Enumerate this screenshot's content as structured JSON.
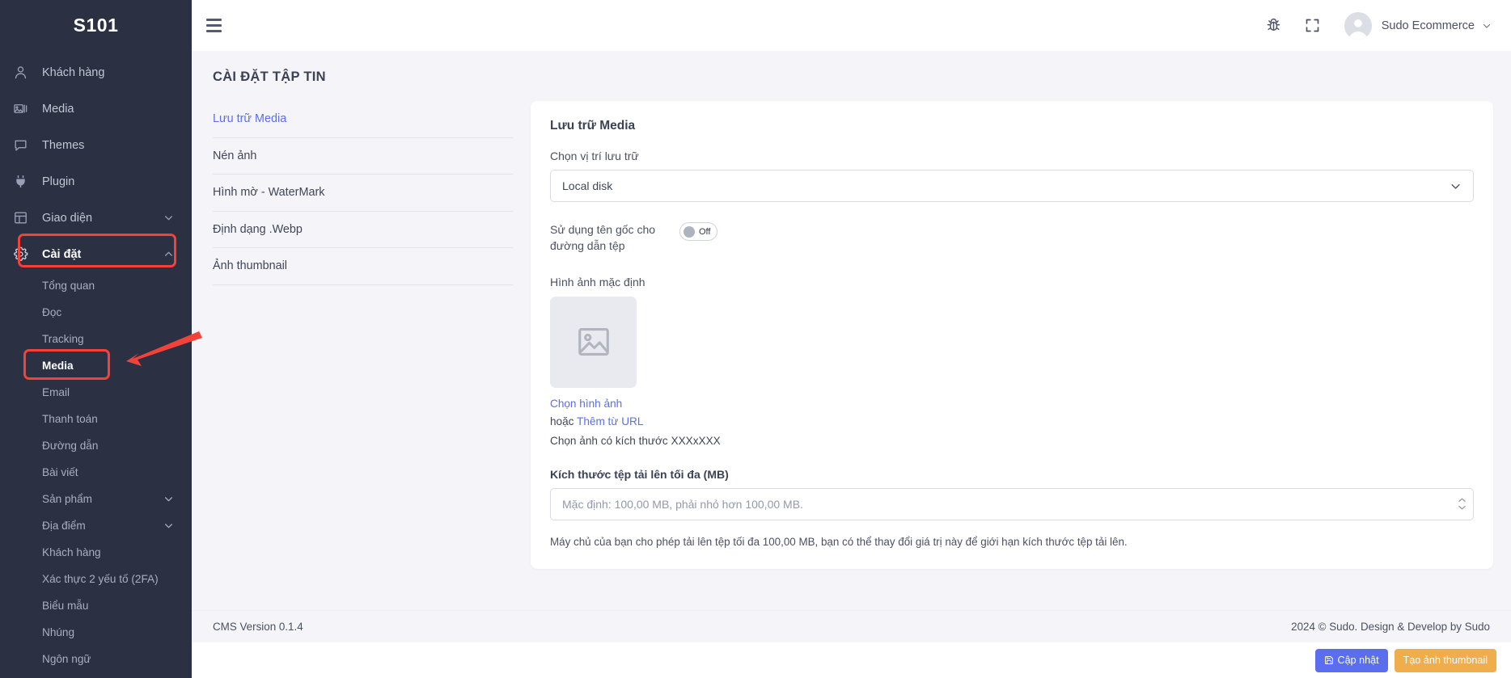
{
  "sidebar": {
    "brand": "S101",
    "items": [
      {
        "label": "Khách hàng",
        "icon": "user-icon",
        "has_chevron": false
      },
      {
        "label": "Media",
        "icon": "images-icon",
        "has_chevron": false
      },
      {
        "label": "Themes",
        "icon": "chat-icon",
        "has_chevron": false
      },
      {
        "label": "Plugin",
        "icon": "plug-icon",
        "has_chevron": false
      },
      {
        "label": "Giao diện",
        "icon": "layout-icon",
        "has_chevron": true,
        "chevron": "chevron-down-icon"
      },
      {
        "label": "Cài đặt",
        "icon": "gear-icon",
        "has_chevron": true,
        "chevron": "chevron-up-icon",
        "active": true,
        "annotated": true
      }
    ],
    "subitems": [
      {
        "label": "Tổng quan"
      },
      {
        "label": "Đọc"
      },
      {
        "label": "Tracking"
      },
      {
        "label": "Media",
        "selected": true,
        "annotated": true
      },
      {
        "label": "Email"
      },
      {
        "label": "Thanh toán"
      },
      {
        "label": "Đường dẫn"
      },
      {
        "label": "Bài viết"
      },
      {
        "label": "Sản phẩm",
        "has_chevron": true
      },
      {
        "label": "Địa điểm",
        "has_chevron": true
      },
      {
        "label": "Khách hàng"
      },
      {
        "label": "Xác thực 2 yếu tố (2FA)"
      },
      {
        "label": "Biểu mẫu"
      },
      {
        "label": "Nhúng"
      },
      {
        "label": "Ngôn ngữ"
      }
    ]
  },
  "topbar": {
    "menu_icon": "hamburger-icon",
    "bug_icon": "bug-icon",
    "fullscreen_icon": "fullscreen-icon",
    "user_name": "Sudo Ecommerce",
    "user_chevron": "chevron-down-icon"
  },
  "page": {
    "title": "CÀI ĐẶT TẬP TIN"
  },
  "tabs": [
    {
      "label": "Lưu trữ Media",
      "active": true
    },
    {
      "label": "Nén ảnh",
      "active": false
    },
    {
      "label": "Hình mờ - WaterMark",
      "active": false
    },
    {
      "label": "Định dạng .Webp",
      "active": false
    },
    {
      "label": "Ảnh thumbnail",
      "active": false
    }
  ],
  "card": {
    "title": "Lưu trữ Media",
    "storage": {
      "label": "Chọn vị trí lưu trữ",
      "value": "Local disk",
      "chevron": "chevron-down-icon"
    },
    "original_name": {
      "label": "Sử dụng tên gốc cho đường dẫn tệp",
      "toggle_state": "Off"
    },
    "default_image": {
      "label": "Hình ảnh mặc định",
      "placeholder_icon": "image-placeholder-icon",
      "choose_link": "Chọn hình ảnh",
      "or_text": "hoặc ",
      "url_link": "Thêm từ URL",
      "hint": "Chọn ảnh có kích thước XXXxXXX"
    },
    "max_size": {
      "label": "Kích thước tệp tải lên tối đa (MB)",
      "placeholder": "Mặc định: 100,00 MB, phải nhỏ hơn 100,00 MB.",
      "value": "",
      "note": "Máy chủ của bạn cho phép tải lên tệp tối đa 100,00 MB, bạn có thể thay đổi giá trị này để giới hạn kích thước tệp tải lên."
    }
  },
  "footer": {
    "version": "CMS Version 0.1.4",
    "copyright": "2024 © Sudo. Design & Develop by Sudo"
  },
  "actions": {
    "update_label": "Cập nhật",
    "update_icon": "save-icon",
    "thumbnail_label": "Tạo ảnh thumbnail"
  },
  "colors": {
    "sidebar_bg": "#2b3043",
    "accent_blue": "#5b6ef0",
    "accent_amber": "#efad4c",
    "annotation_red": "#f4423a",
    "content_bg": "#f5f5f9"
  }
}
